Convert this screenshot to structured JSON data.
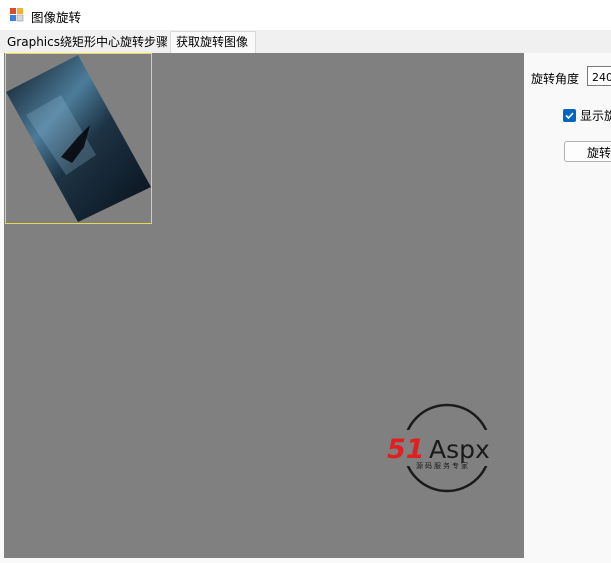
{
  "window": {
    "title": "图像旋转"
  },
  "tabs": [
    {
      "label": "Graphics绕矩形中心旋转步骤"
    },
    {
      "label": "获取旋转图像"
    }
  ],
  "controls": {
    "angle_label": "旋转角度",
    "angle_value": "240",
    "show_checkbox_label": "显示旋",
    "show_checkbox_checked": true,
    "rotate_button_label": "旋转"
  },
  "logo": {
    "brand_51": "51",
    "brand_aspx": "Aspx",
    "slogan": "源码服务专家"
  },
  "colors": {
    "canvas": "#808080",
    "selection_border": "#e8d94a",
    "logo_red": "#e02020",
    "logo_green": "#2ea02e",
    "checkbox_blue": "#0067c0"
  }
}
